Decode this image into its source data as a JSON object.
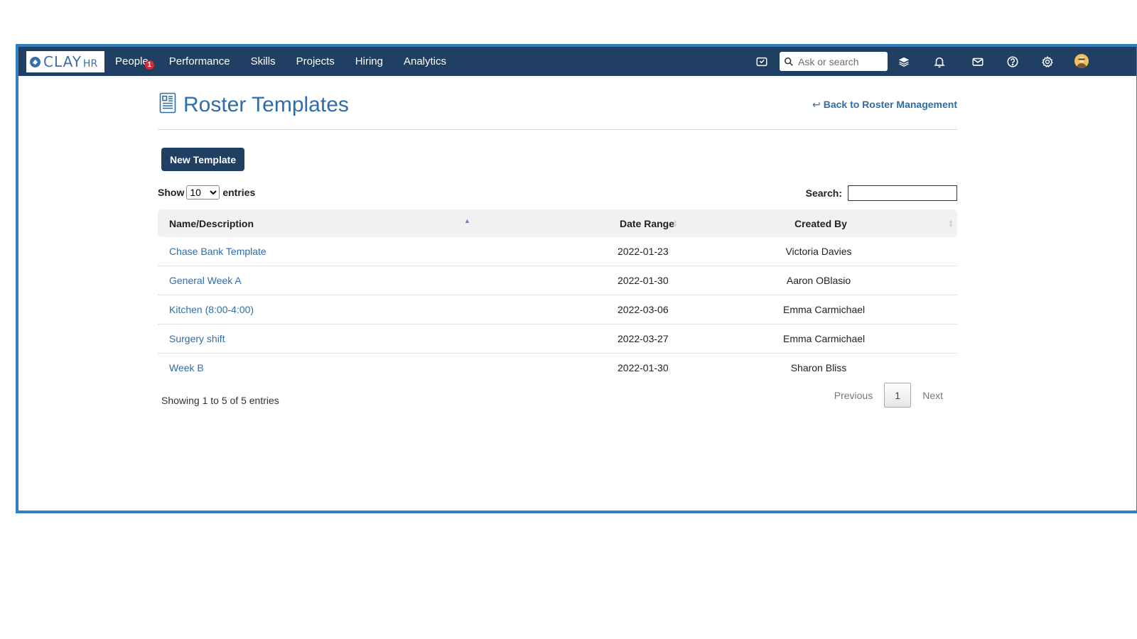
{
  "app": {
    "logo_text": "CLAY",
    "logo_sub": "HR",
    "nav": [
      {
        "label": "People",
        "badge": "1"
      },
      {
        "label": "Performance"
      },
      {
        "label": "Skills"
      },
      {
        "label": "Projects"
      },
      {
        "label": "Hiring"
      },
      {
        "label": "Analytics"
      }
    ],
    "search": {
      "placeholder": "Ask or search"
    },
    "icons": [
      "inbox-check-icon",
      "layers-icon",
      "bell-icon",
      "mail-icon",
      "help-icon",
      "gear-icon",
      "avatar"
    ],
    "colors": {
      "topbar": "#1f3f63",
      "link": "#2f6da8",
      "frame_border": "#2f7fc4",
      "badge": "#e0262f"
    }
  },
  "page": {
    "title": "Roster Templates",
    "back_link": "Back to Roster Management",
    "new_button": "New Template",
    "show_prefix": "Show",
    "show_value": "10",
    "show_options": [
      "10"
    ],
    "show_suffix": "entries",
    "search_label": "Search:"
  },
  "table": {
    "columns": [
      "Name/Description",
      "Date Range",
      "Created By"
    ],
    "rows": [
      {
        "name": "Chase Bank Template",
        "date": "2022-01-23",
        "created_by": "Victoria Davies"
      },
      {
        "name": "General Week A",
        "date": "2022-01-30",
        "created_by": "Aaron OBlasio"
      },
      {
        "name": "Kitchen (8:00-4:00)",
        "date": "2022-03-06",
        "created_by": "Emma Carmichael"
      },
      {
        "name": "Surgery shift",
        "date": "2022-03-27",
        "created_by": "Emma Carmichael"
      },
      {
        "name": "Week B",
        "date": "2022-01-30",
        "created_by": "Sharon Bliss"
      }
    ]
  },
  "footer": {
    "info": "Showing 1 to 5 of 5 entries",
    "previous": "Previous",
    "current_page": "1",
    "next": "Next"
  }
}
